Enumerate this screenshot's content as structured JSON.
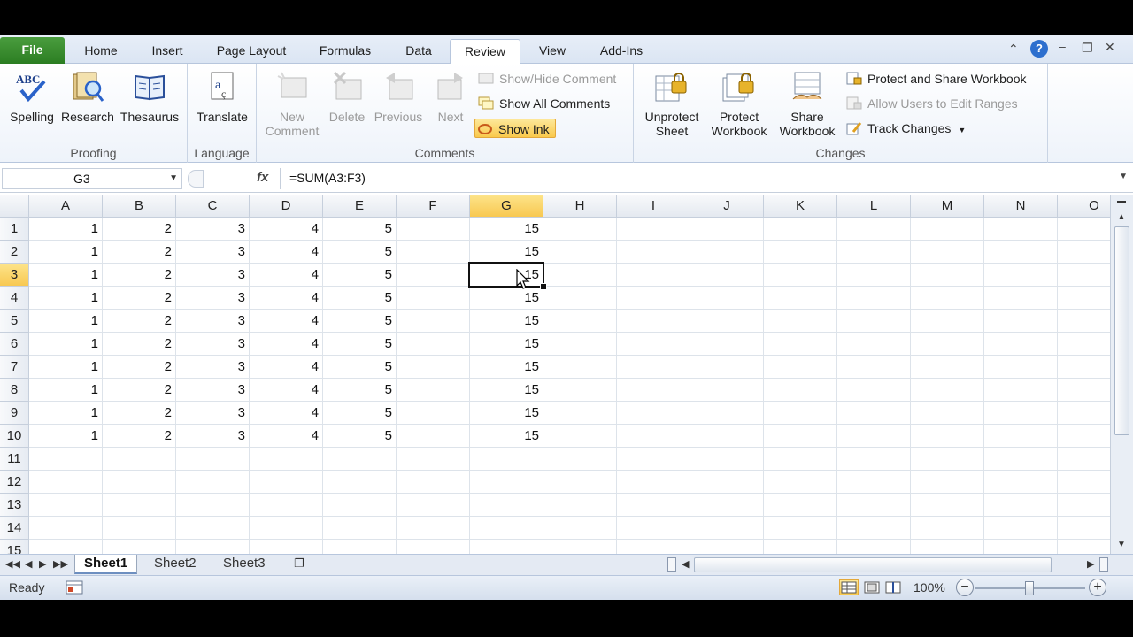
{
  "tabs": [
    {
      "label": "File"
    },
    {
      "label": "Home"
    },
    {
      "label": "Insert"
    },
    {
      "label": "Page Layout"
    },
    {
      "label": "Formulas"
    },
    {
      "label": "Data"
    },
    {
      "label": "Review"
    },
    {
      "label": "View"
    },
    {
      "label": "Add-Ins"
    }
  ],
  "ribbon": {
    "proofing": {
      "label": "Proofing",
      "spelling": "Spelling",
      "spelling_icon_text": "ABC",
      "research": "Research",
      "thesaurus": "Thesaurus"
    },
    "language": {
      "label": "Language",
      "translate": "Translate"
    },
    "comments": {
      "label": "Comments",
      "new_comment": "New Comment",
      "delete": "Delete",
      "previous": "Previous",
      "next": "Next",
      "show_hide": "Show/Hide Comment",
      "show_all": "Show All Comments",
      "show_ink": "Show Ink"
    },
    "changes": {
      "label": "Changes",
      "unprotect_sheet": "Unprotect Sheet",
      "protect_workbook": "Protect Workbook",
      "share_workbook": "Share Workbook",
      "protect_share": "Protect and Share Workbook",
      "allow_users": "Allow Users to Edit Ranges",
      "track_changes": "Track Changes"
    }
  },
  "formula_bar": {
    "name_box": "G3",
    "fx": "fx",
    "formula": "=SUM(A3:F3)"
  },
  "grid": {
    "columns": [
      "A",
      "B",
      "C",
      "D",
      "E",
      "F",
      "G",
      "H",
      "I",
      "J",
      "K",
      "L",
      "M",
      "N",
      "O"
    ],
    "rows": [
      "1",
      "2",
      "3",
      "4",
      "5",
      "6",
      "7",
      "8",
      "9",
      "10",
      "11",
      "12",
      "13",
      "14",
      "15"
    ],
    "data": [
      [
        "1",
        "2",
        "3",
        "4",
        "5",
        "",
        "15"
      ],
      [
        "1",
        "2",
        "3",
        "4",
        "5",
        "",
        "15"
      ],
      [
        "1",
        "2",
        "3",
        "4",
        "5",
        "",
        "15"
      ],
      [
        "1",
        "2",
        "3",
        "4",
        "5",
        "",
        "15"
      ],
      [
        "1",
        "2",
        "3",
        "4",
        "5",
        "",
        "15"
      ],
      [
        "1",
        "2",
        "3",
        "4",
        "5",
        "",
        "15"
      ],
      [
        "1",
        "2",
        "3",
        "4",
        "5",
        "",
        "15"
      ],
      [
        "1",
        "2",
        "3",
        "4",
        "5",
        "",
        "15"
      ],
      [
        "1",
        "2",
        "3",
        "4",
        "5",
        "",
        "15"
      ],
      [
        "1",
        "2",
        "3",
        "4",
        "5",
        "",
        "15"
      ]
    ],
    "selected_col": "G",
    "selected_row": "3"
  },
  "sheets": [
    "Sheet1",
    "Sheet2",
    "Sheet3"
  ],
  "active_sheet": "Sheet1",
  "status": {
    "text": "Ready",
    "zoom": "100%"
  },
  "colors": {
    "accent": "#f8c851",
    "file_tab": "#2b7d22"
  }
}
